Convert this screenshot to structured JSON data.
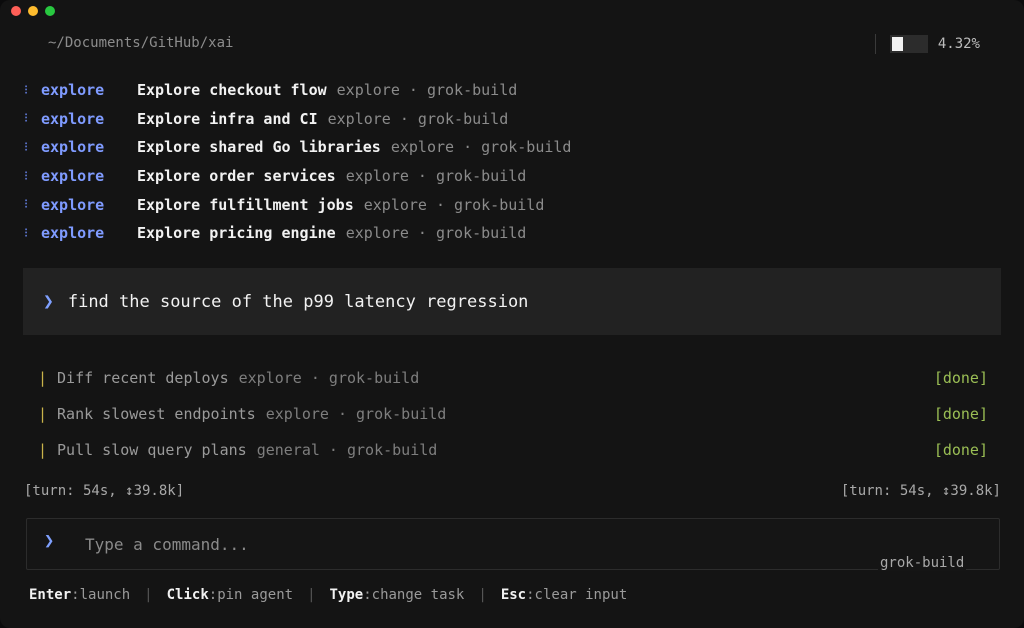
{
  "window": {
    "path": "~/Documents/GitHub/xai",
    "usage_percent": "4.32%",
    "usage_fraction": 0.0432
  },
  "agents": [
    {
      "kind": "explore",
      "title": "Explore checkout flow",
      "meta": "explore · grok-build"
    },
    {
      "kind": "explore",
      "title": "Explore infra and CI",
      "meta": "explore · grok-build"
    },
    {
      "kind": "explore",
      "title": "Explore shared Go libraries",
      "meta": "explore · grok-build"
    },
    {
      "kind": "explore",
      "title": "Explore order services",
      "meta": "explore · grok-build"
    },
    {
      "kind": "explore",
      "title": "Explore fulfillment jobs",
      "meta": "explore · grok-build"
    },
    {
      "kind": "explore",
      "title": "Explore pricing engine",
      "meta": "explore · grok-build"
    }
  ],
  "prompt": {
    "chevron": "❯",
    "text": "find the source of the p99 latency regression"
  },
  "tasks": [
    {
      "title": "Diff recent deploys",
      "meta": "explore · grok-build",
      "status": "[done]"
    },
    {
      "title": "Rank slowest endpoints",
      "meta": "explore · grok-build",
      "status": "[done]"
    },
    {
      "title": "Pull slow query plans",
      "meta": "general · grok-build",
      "status": "[done]"
    }
  ],
  "turn": {
    "left": "[turn: 54s, ↕39.8k]",
    "right": "[turn: 54s, ↕39.8k]"
  },
  "input": {
    "chevron": "❯",
    "placeholder": "Type a command...",
    "value": "",
    "model": "grok-build"
  },
  "footer": [
    {
      "key": "Enter",
      "action": ":launch"
    },
    {
      "key": "Click",
      "action": ":pin agent"
    },
    {
      "key": "Type",
      "action": ":change task"
    },
    {
      "key": "Esc",
      "action": ":clear input"
    }
  ],
  "colors": {
    "accent": "#7f9bff",
    "done": "#9bbf55",
    "task_bar": "#c9b34a"
  }
}
